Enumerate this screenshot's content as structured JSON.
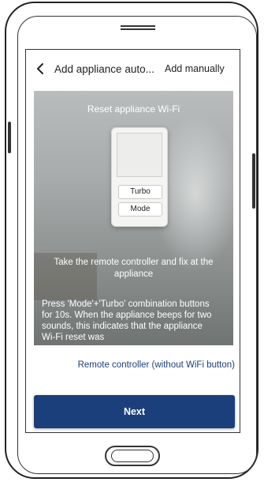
{
  "header": {
    "title": "Add appliance auto...",
    "add_manually": "Add manually"
  },
  "illustration": {
    "heading": "Reset appliance Wi-Fi",
    "remote_buttons": [
      "Turbo",
      "Mode"
    ],
    "instruction": "Take the remote controller and fix at the appliance",
    "detail": "Press 'Mode'+'Turbo' combination buttons for 10s. When the appliance beeps for two sounds, this indicates that the appliance Wi-Fi reset was"
  },
  "remote_link": "Remote controller (without WiFi button)",
  "next_label": "Next",
  "colors": {
    "primary": "#1a3f7a",
    "link": "#1c3f7a"
  },
  "icons": {
    "back": "chevron-left-icon"
  }
}
